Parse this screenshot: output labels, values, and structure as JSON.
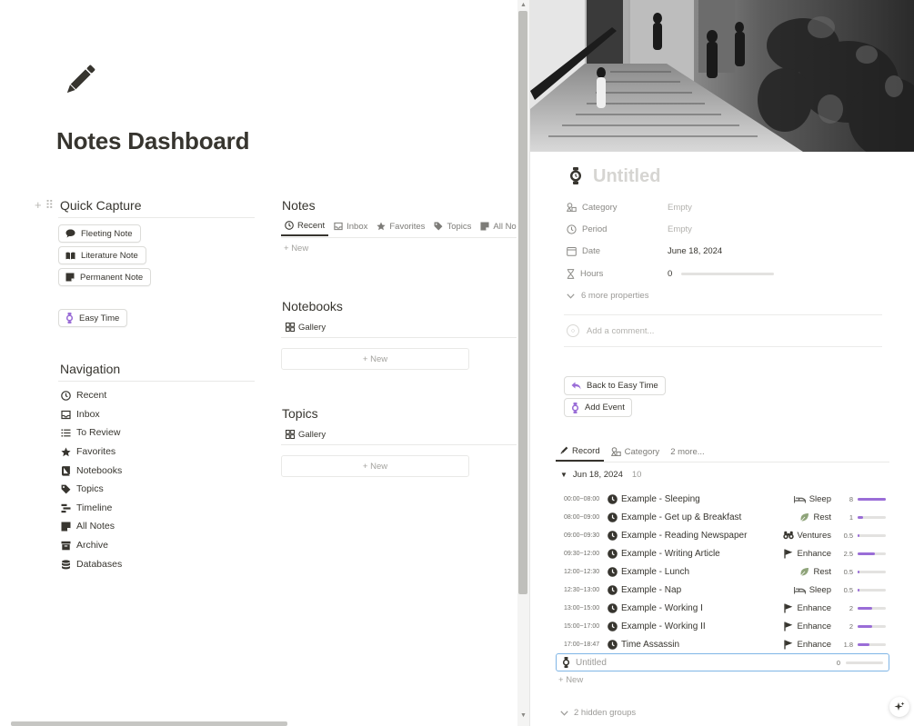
{
  "page": {
    "title": "Notes Dashboard",
    "icon": "pencil-icon"
  },
  "quick_capture": {
    "heading": "Quick Capture",
    "buttons": [
      {
        "label": "Fleeting Note",
        "icon": "speech-bubble-icon"
      },
      {
        "label": "Literature Note",
        "icon": "book-open-icon"
      },
      {
        "label": "Permanent Note",
        "icon": "note-icon"
      }
    ],
    "easy_time": {
      "label": "Easy Time",
      "icon": "watch-icon"
    }
  },
  "navigation": {
    "heading": "Navigation",
    "items": [
      {
        "label": "Recent",
        "icon": "clock-icon"
      },
      {
        "label": "Inbox",
        "icon": "inbox-icon"
      },
      {
        "label": "To Review",
        "icon": "list-icon"
      },
      {
        "label": "Favorites",
        "icon": "star-icon"
      },
      {
        "label": "Notebooks",
        "icon": "notebook-icon"
      },
      {
        "label": "Topics",
        "icon": "tag-icon"
      },
      {
        "label": "Timeline",
        "icon": "timeline-icon"
      },
      {
        "label": "All Notes",
        "icon": "note-icon"
      },
      {
        "label": "Archive",
        "icon": "archive-icon"
      },
      {
        "label": "Databases",
        "icon": "database-icon"
      }
    ]
  },
  "notes": {
    "heading": "Notes",
    "tabs": [
      {
        "label": "Recent",
        "icon": "clock-icon",
        "active": true
      },
      {
        "label": "Inbox",
        "icon": "inbox-icon"
      },
      {
        "label": "Favorites",
        "icon": "star-icon"
      },
      {
        "label": "Topics",
        "icon": "tag-icon"
      },
      {
        "label": "All Not",
        "icon": "note-icon"
      }
    ],
    "new_label": "New"
  },
  "notebooks": {
    "heading": "Notebooks",
    "view": "Gallery",
    "new_label": "New"
  },
  "topics": {
    "heading": "Topics",
    "view": "Gallery",
    "new_label": "New"
  },
  "record": {
    "title_placeholder": "Untitled",
    "properties": [
      {
        "label": "Category",
        "value": "Empty",
        "empty": true,
        "icon": "category-icon"
      },
      {
        "label": "Period",
        "value": "Empty",
        "empty": true,
        "icon": "clock-icon"
      },
      {
        "label": "Date",
        "value": "June 18, 2024",
        "empty": false,
        "icon": "calendar-icon"
      },
      {
        "label": "Hours",
        "value": "0",
        "empty": false,
        "icon": "hourglass-icon",
        "progress": 0
      }
    ],
    "more_properties": "6 more properties",
    "comment_placeholder": "Add a comment...",
    "buttons": [
      {
        "label": "Back to Easy Time",
        "icon": "back-arrow-icon"
      },
      {
        "label": "Add Event",
        "icon": "watch-icon"
      }
    ],
    "tabs": [
      {
        "label": "Record",
        "icon": "pencil-icon",
        "active": true
      },
      {
        "label": "Category",
        "icon": "category-icon"
      },
      {
        "label": "2 more..."
      }
    ],
    "group": {
      "label": "Jun 18, 2024",
      "count": "10"
    },
    "rows": [
      {
        "time": "00:00~08:00",
        "name": "Example - Sleeping",
        "category": "Sleep",
        "cat_icon": "bed-icon",
        "hours": "8",
        "progress": 1.0
      },
      {
        "time": "08:00~09:00",
        "name": "Example - Get up & Breakfast",
        "category": "Rest",
        "cat_icon": "leaf-icon",
        "hours": "1",
        "progress": 0.2
      },
      {
        "time": "09:00~09:30",
        "name": "Example - Reading Newspaper",
        "category": "Ventures",
        "cat_icon": "binoculars-icon",
        "hours": "0.5",
        "progress": 0.08
      },
      {
        "time": "09:30~12:00",
        "name": "Example - Writing Article",
        "category": "Enhance",
        "cat_icon": "flag-icon",
        "hours": "2.5",
        "progress": 0.6
      },
      {
        "time": "12:00~12:30",
        "name": "Example - Lunch",
        "category": "Rest",
        "cat_icon": "leaf-icon",
        "hours": "0.5",
        "progress": 0.08
      },
      {
        "time": "12:30~13:00",
        "name": "Example - Nap",
        "category": "Sleep",
        "cat_icon": "bed-icon",
        "hours": "0.5",
        "progress": 0.08
      },
      {
        "time": "13:00~15:00",
        "name": "Example - Working I",
        "category": "Enhance",
        "cat_icon": "flag-icon",
        "hours": "2",
        "progress": 0.5
      },
      {
        "time": "15:00~17:00",
        "name": "Example - Working II",
        "category": "Enhance",
        "cat_icon": "flag-icon",
        "hours": "2",
        "progress": 0.5
      },
      {
        "time": "17:00~18:47",
        "name": "Time Assassin",
        "category": "Enhance",
        "cat_icon": "flag-icon",
        "hours": "1.8",
        "progress": 0.42
      }
    ],
    "new_row": {
      "name": "Untitled",
      "hours": "0"
    },
    "add_new": "New",
    "hidden_groups": "2 hidden groups"
  },
  "colors": {
    "accent": "#9a6dd7",
    "text": "#37352f",
    "muted": "#9b9a97",
    "selection": "#7fb5e6"
  }
}
